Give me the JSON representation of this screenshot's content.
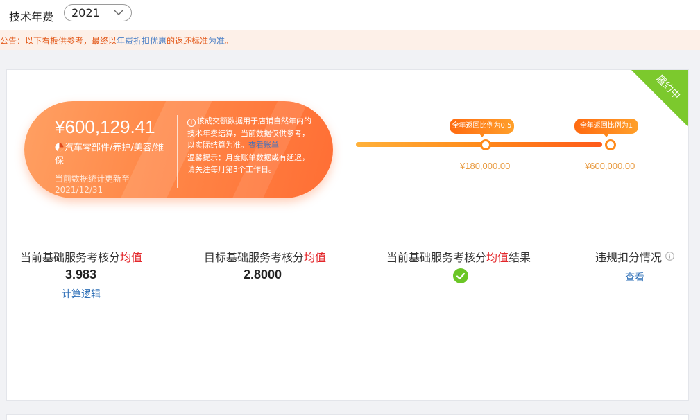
{
  "header": {
    "title": "技术年费",
    "year": "2021"
  },
  "notice": {
    "prefix": "公告：以下看板供参考，最终以",
    "link1": "年费折扣优惠",
    "mid": "的返还标准",
    "link2": "为准",
    "suffix": "。"
  },
  "badge": {
    "text": "履约中",
    "color": "#7cc92d"
  },
  "summary": {
    "amount": "¥600,129.41",
    "category": "汽车零部件/养护/美容/维保",
    "updated": "当前数据统计更新至2021/12/31",
    "desc_main": "该成交额数据用于店铺自然年内的技术年费结算，当前数据仅供参考，以实际结算为准。",
    "desc_link": "查看账单",
    "desc_tip": "温馨提示：月度账单数据或有延迟，请关注每月第3个工作日。"
  },
  "progress": {
    "fill_fraction": 1.0,
    "milestones": [
      {
        "label": "全年返回比例为0.5",
        "value": "¥180,000.00"
      },
      {
        "label": "全年返回比例为1",
        "value": "¥600,000.00"
      }
    ]
  },
  "stats": [
    {
      "label_pre": "当前基础服务考核分",
      "label_red": "均值",
      "label_post": "",
      "value": "3.983",
      "link": "计算逻辑"
    },
    {
      "label_pre": "目标基础服务考核分",
      "label_red": "均值",
      "label_post": "",
      "value": "2.8000"
    },
    {
      "label_pre": "当前基础服务考核分",
      "label_red": "均值",
      "label_post": "结果"
    },
    {
      "label_pre": "违规扣分情况",
      "link": "查看"
    }
  ],
  "colors": {
    "accent": "#ff7a3a",
    "link": "#2e6fb7",
    "success": "#6bc626",
    "red": "#e3262a"
  }
}
